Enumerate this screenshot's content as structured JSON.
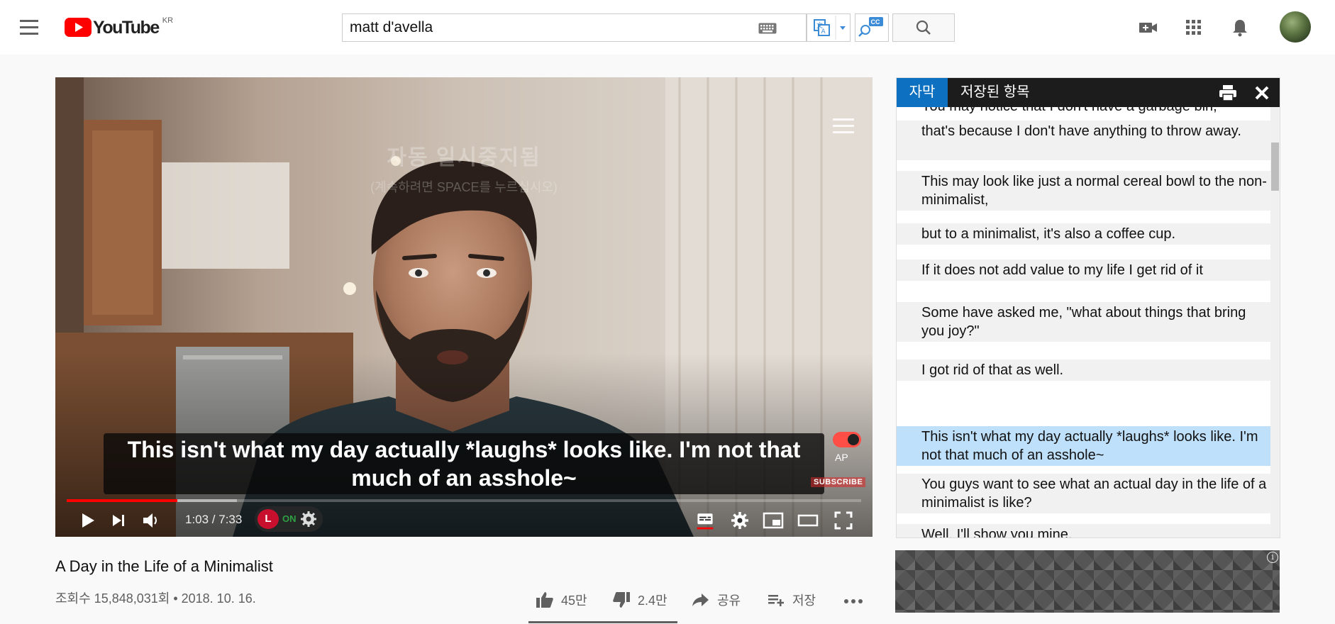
{
  "header": {
    "logo_text": "YouTube",
    "country_code": "KR",
    "search_value": "matt d'avella"
  },
  "player": {
    "pause_title": "자동 일시중지됨",
    "pause_hint": "(계속하려면 SPACE를 누르십시오)",
    "caption_line1": "This isn't what my day actually *laughs* looks like. I'm not that",
    "caption_line2": "much of an asshole~",
    "autoplay_label": "AP",
    "subscribe_watermark": "SUBSCRIBE",
    "time_display": "1:03 / 7:33",
    "progress": 0.139,
    "extension_status": "ON",
    "extension_logo": "L"
  },
  "transcript": {
    "tab_active": "자막",
    "tab_saved": "저장된 항목",
    "rows": [
      {
        "text": "You may notice that I don't have a garbage bin,",
        "style": "plain"
      },
      {
        "text": "that's because I don't have anything to throw away.",
        "style": "shaded"
      },
      {
        "text": "This may look like just a normal cereal bowl to the non-minimalist,",
        "style": "shaded"
      },
      {
        "text": "but to a minimalist, it's also a coffee cup.",
        "style": "shaded"
      },
      {
        "text": "If it does not add value to my life I get rid of it",
        "style": "shaded"
      },
      {
        "text": "Some have asked me, \"what about things that bring you joy?\"",
        "style": "shaded"
      },
      {
        "text": "I got rid of that as well.",
        "style": "shaded"
      },
      {
        "text": "This isn't what my day actually *laughs* looks like. I'm not that much of an asshole~",
        "style": "active"
      },
      {
        "text": "You guys want to see what an actual day in the life of a minimalist is like?",
        "style": "shaded"
      },
      {
        "text": "Well, I'll show you mine.",
        "style": "shaded"
      }
    ]
  },
  "video": {
    "title": "A Day in the Life of a Minimalist",
    "meta": "조회수 15,848,031회 • 2018. 10. 16.",
    "likes": "45만",
    "dislikes": "2.4만",
    "share": "공유",
    "save": "저장"
  },
  "ad": {
    "info_glyph": "i"
  },
  "colors": {
    "accent_red": "#ff0000",
    "tab_blue": "#0e70c0",
    "active_row": "#bfe0fa"
  },
  "icons": [
    "menu-icon",
    "youtube-logo-icon",
    "keyboard-icon",
    "translate-icon",
    "caption-search-icon",
    "search-icon",
    "create-video-icon",
    "apps-icon",
    "bell-icon",
    "play-icon",
    "next-icon",
    "volume-icon",
    "settings-icon",
    "subtitles-icon",
    "miniplayer-icon",
    "theater-icon",
    "fullscreen-icon",
    "print-icon",
    "close-icon",
    "like-icon",
    "dislike-icon",
    "share-icon",
    "save-icon",
    "more-icon"
  ]
}
